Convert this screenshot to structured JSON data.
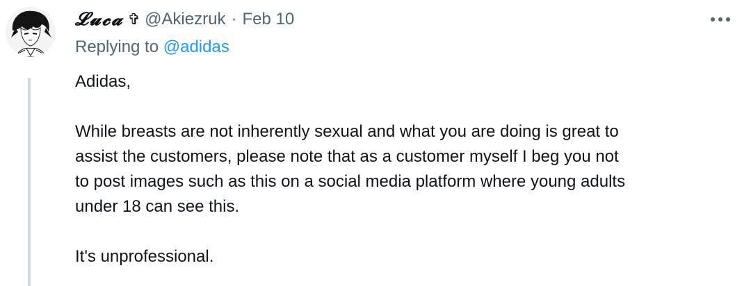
{
  "tweet": {
    "display_name": "𝓛𝓾𝓬𝓪",
    "name_symbol": "✞",
    "handle": "@Akiezruk",
    "separator": "·",
    "date": "Feb 10",
    "avatar_icon": "anime-avatar-icon",
    "more_icon": "more-dots-icon",
    "replying_prefix": "Replying to",
    "replying_handle": "@adidas",
    "body": {
      "p1": "Adidas,",
      "p2_l1": "While breasts are not inherently sexual and what you are doing is great to",
      "p2_l2": "assist the customers, please note that as a customer myself I beg you not",
      "p2_l3": "to post images such as this on a social media platform where young adults",
      "p2_l4": "under 18 can see this.",
      "p3": "It's unprofessional."
    }
  },
  "colors": {
    "text": "#0f1419",
    "secondary": "#536471",
    "link": "#1d9bf0",
    "thread_line": "#cfd9de"
  }
}
